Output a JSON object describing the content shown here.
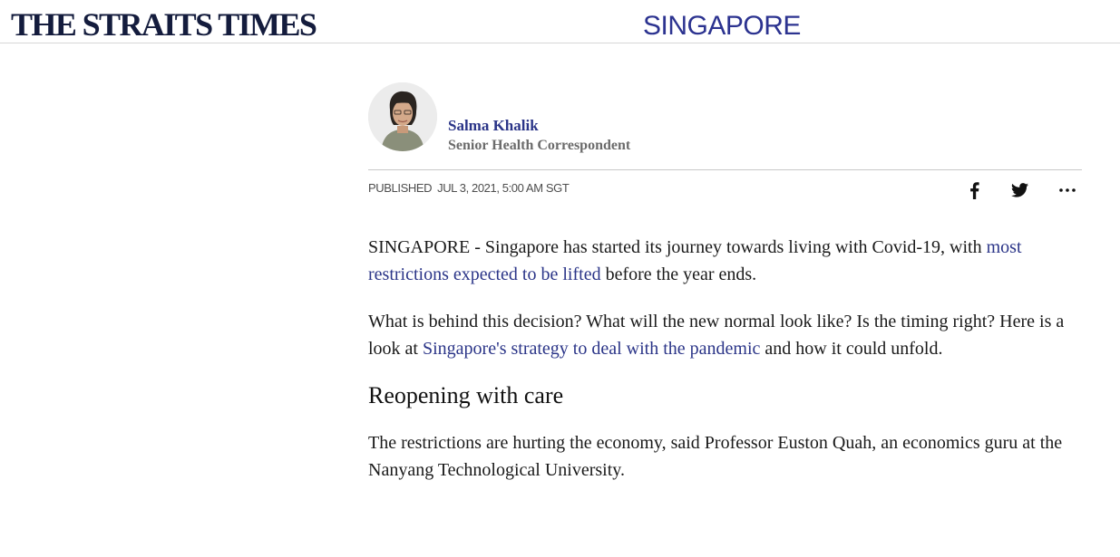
{
  "header": {
    "logo": "THE STRAITS TIMES",
    "section": "SINGAPORE"
  },
  "author": {
    "name": "Salma Khalik",
    "role": "Senior Health Correspondent"
  },
  "meta": {
    "published_label": "PUBLISHED",
    "published_date": "JUL 3, 2021, 5:00 AM SGT"
  },
  "share": {
    "icons": [
      "facebook-icon",
      "twitter-icon",
      "more-icon"
    ]
  },
  "article": {
    "p1_before": "SINGAPORE - Singapore has started its journey towards living with Covid-19, with ",
    "p1_link": "most restrictions expected to be lifted",
    "p1_after": " before the year ends.",
    "p2_before": "What is behind this decision? What will the new normal look like? Is the timing right? Here is a look at ",
    "p2_link": "Singapore's strategy to deal with the pandemic",
    "p2_after": " and how it could unfold.",
    "heading": "Reopening with care",
    "p3": "The restrictions are hurting the economy, said Professor Euston Quah, an economics guru at the Nanyang Technological University."
  },
  "colors": {
    "brand_navy": "#141c3d",
    "link_blue": "#2b3588",
    "section_blue": "#2c3390"
  }
}
